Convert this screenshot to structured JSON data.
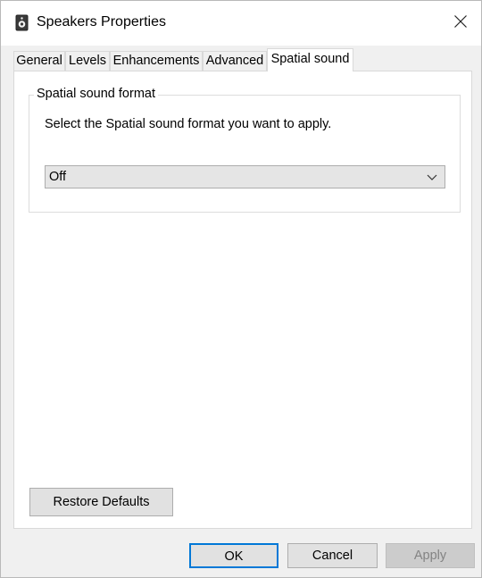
{
  "window": {
    "title": "Speakers Properties",
    "icon": "speaker-icon",
    "close_icon": "close-icon"
  },
  "tabs": [
    {
      "label": "General",
      "active": false
    },
    {
      "label": "Levels",
      "active": false
    },
    {
      "label": "Enhancements",
      "active": false
    },
    {
      "label": "Advanced",
      "active": false
    },
    {
      "label": "Spatial sound",
      "active": true
    }
  ],
  "spatial": {
    "group_label": "Spatial sound format",
    "description": "Select the Spatial sound format you want to apply.",
    "format_value": "Off",
    "dropdown_icon": "chevron-down-icon"
  },
  "buttons": {
    "restore_defaults": "Restore Defaults",
    "ok": "OK",
    "cancel": "Cancel",
    "apply": "Apply"
  },
  "colors": {
    "focus_border": "#0078d7",
    "disabled_text": "#838383"
  }
}
